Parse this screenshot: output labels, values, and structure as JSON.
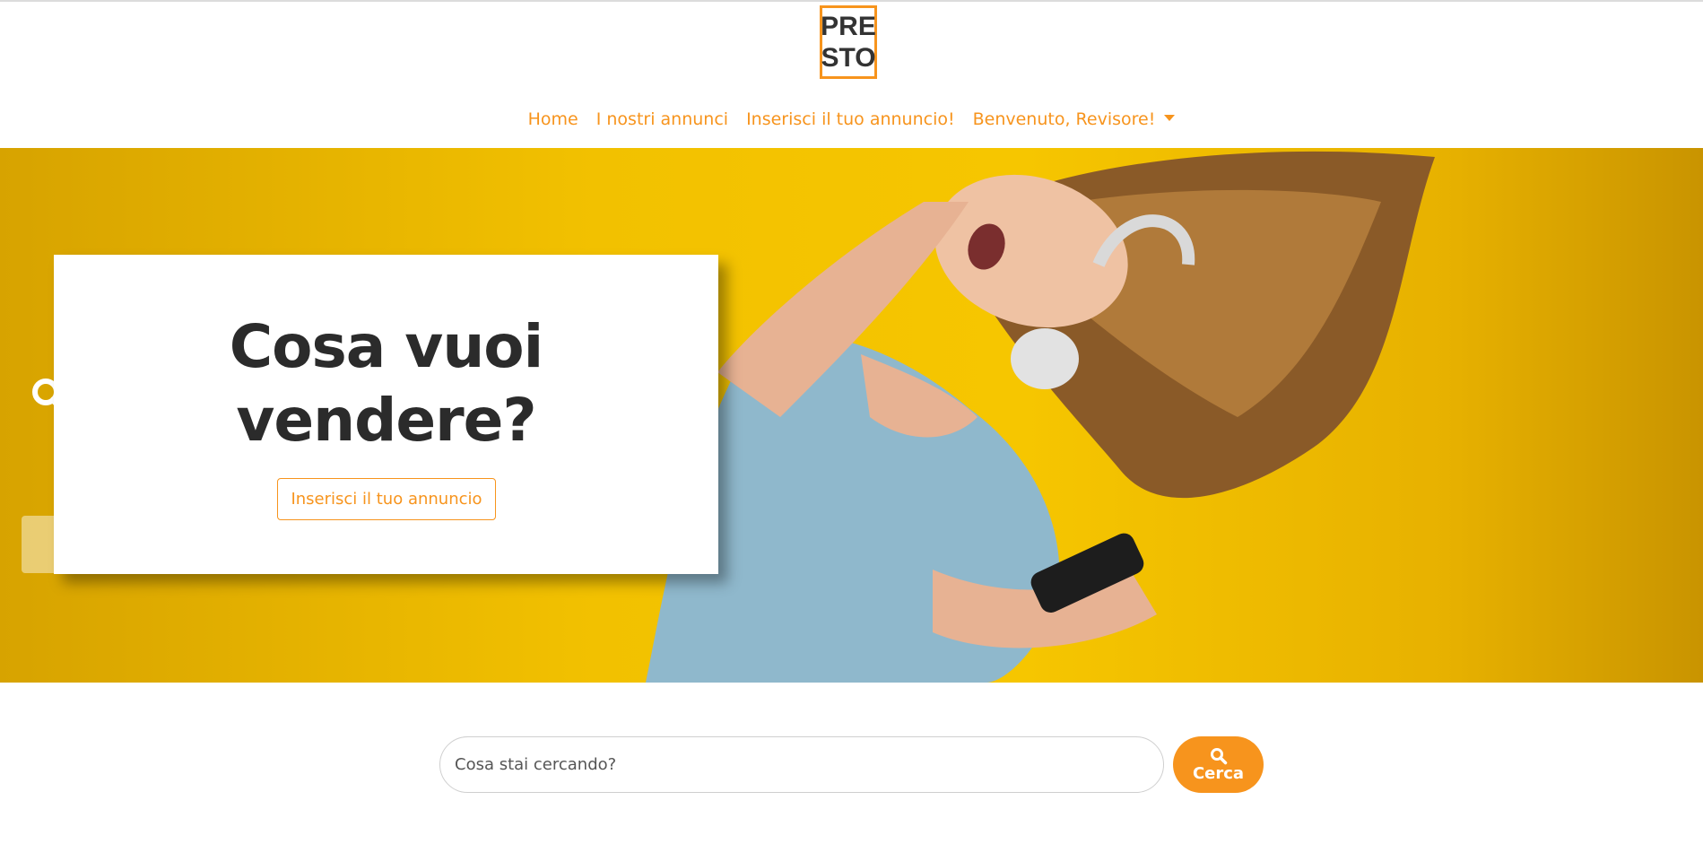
{
  "brand": {
    "logo_line1": "PRE",
    "logo_line2": "STO",
    "accent_color": "#f7941d"
  },
  "nav": {
    "items": [
      {
        "label": "Home"
      },
      {
        "label": "I nostri annunci"
      },
      {
        "label": "Inserisci il tuo annuncio!"
      },
      {
        "label": "Benvenuto, Revisore!"
      }
    ]
  },
  "hero": {
    "title_line1": "Cosa vuoi",
    "title_line2": "vendere?",
    "cta_label": "Inserisci il tuo annuncio"
  },
  "search": {
    "placeholder": "Cosa stai cercando?",
    "button_label": "Cerca"
  },
  "icons": {
    "search": "search-icon",
    "dropdown": "caret-down-icon"
  }
}
